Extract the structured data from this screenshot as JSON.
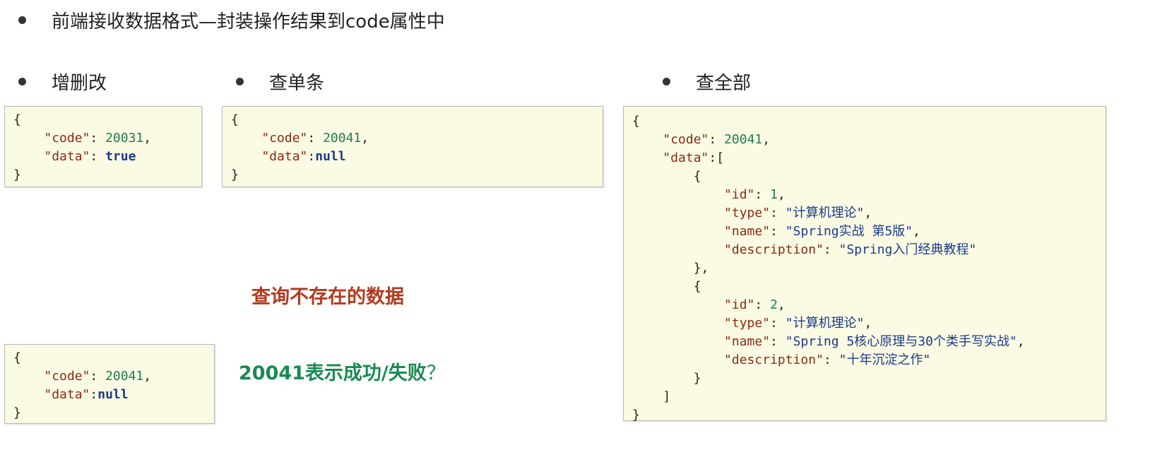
{
  "title": "前端接收数据格式—封装操作结果到code属性中",
  "sections": {
    "crud": "增删改",
    "get_one": "查单条",
    "get_all": "查全部"
  },
  "box_crud": {
    "open": "{",
    "code_key": "\"code\"",
    "code_val": "20031",
    "data_key": "\"data\"",
    "data_val": "true",
    "close": "}"
  },
  "box_get_one": {
    "open": "{",
    "code_key": "\"code\"",
    "code_val": "20041",
    "data_key": "\"data\"",
    "data_val": "null",
    "close": "}"
  },
  "box_not_found": {
    "open": "{",
    "code_key": "\"code\"",
    "code_val": "20041",
    "data_key": "\"data\"",
    "data_val": "null",
    "close": "}"
  },
  "box_get_all": {
    "code_key": "\"code\"",
    "code_val": "20041",
    "data_key": "\"data\"",
    "items": [
      {
        "id": "1",
        "type": "\"计算机理论\"",
        "name": "\"Spring实战 第5版\"",
        "description": "\"Spring入门经典教程\""
      },
      {
        "id": "2",
        "type": "\"计算机理论\"",
        "name": "\"Spring 5核心原理与30个类手写实战\"",
        "description": "\"十年沉淀之作\""
      }
    ],
    "labels": {
      "id": "\"id\"",
      "type": "\"type\"",
      "name": "\"name\"",
      "description": "\"description\""
    }
  },
  "annotations": {
    "query_missing": "查询不存在的数据",
    "question_main": "20041表示成功/失败",
    "question_mark": "？"
  }
}
